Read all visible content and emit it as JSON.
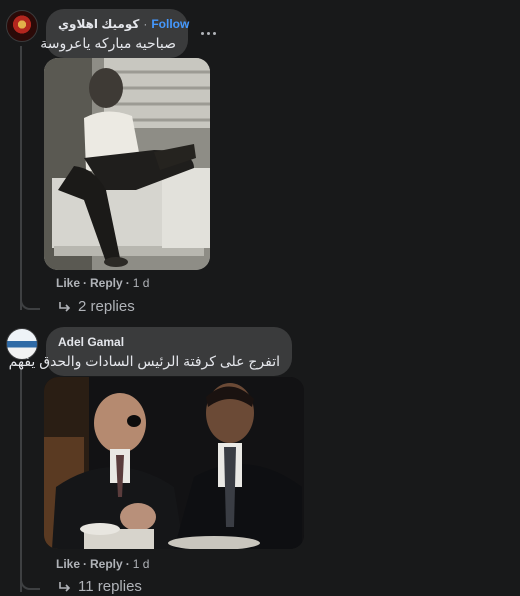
{
  "comments": [
    {
      "author": "كوميك اهلاوي",
      "follow_label": "Follow",
      "separator": "·",
      "text": "صباحيه مباركه ياعروسة",
      "actions": {
        "like": "Like",
        "reply": "Reply",
        "time": "1 d"
      },
      "replies_label": "2 replies"
    },
    {
      "author": "Adel Gamal",
      "text": "اتفرج على كرفتة الرئيس السادات والحدق يفهم",
      "actions": {
        "like": "Like",
        "reply": "Reply",
        "time": "1 d"
      },
      "replies_label": "11 replies"
    }
  ],
  "ui": {
    "action_separator": "·",
    "more_icon": "ellipsis-horizontal-icon",
    "reply_icon": "reply-arrow-icon"
  },
  "colors": {
    "background": "#18191a",
    "bubble": "#3a3b3c",
    "follow": "#4599ff",
    "muted": "#b0b3b8"
  }
}
